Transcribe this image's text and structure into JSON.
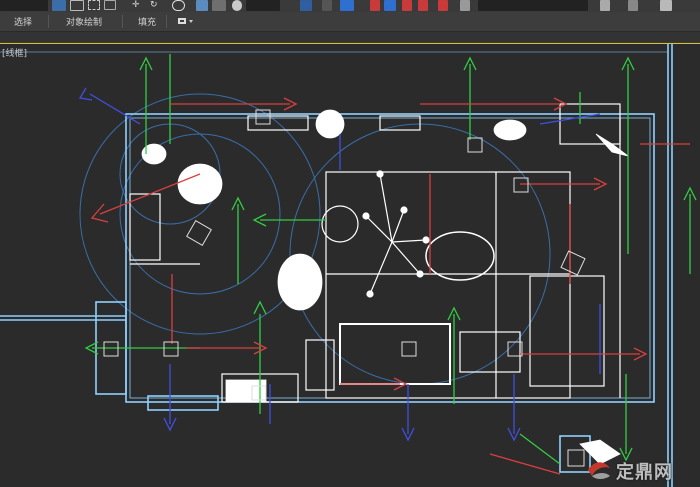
{
  "toolbar": {
    "buttons": [
      "select-object",
      "select-by-name",
      "select-region",
      "window-crossing",
      "move",
      "rotate",
      "scale",
      "mirror",
      "align",
      "layer-manager",
      "material-editor",
      "render-setup",
      "render",
      "named-selection-set",
      "snap-toggle",
      "angle-snap",
      "percent-snap",
      "spinner-snap",
      "edit-named-selections",
      "curve-editor",
      "schematic-view"
    ],
    "named_selection_value": ""
  },
  "ribbon": {
    "tabs": [
      "选择",
      "对象绘制",
      "填充"
    ]
  },
  "viewport": {
    "label": "[线框]",
    "display_mode": "wireframe"
  },
  "watermark": {
    "text": "定鼎网"
  },
  "colors": {
    "background": "#2b2b2b",
    "wireframe": "#ffffff",
    "room_outline": "#8fd0ff",
    "gizmo_green": "#33cc44",
    "gizmo_red": "#d84040",
    "gizmo_blue": "#4050e0",
    "light_circle": "#3a6ea8",
    "viewport_border": "#d8c23a"
  }
}
